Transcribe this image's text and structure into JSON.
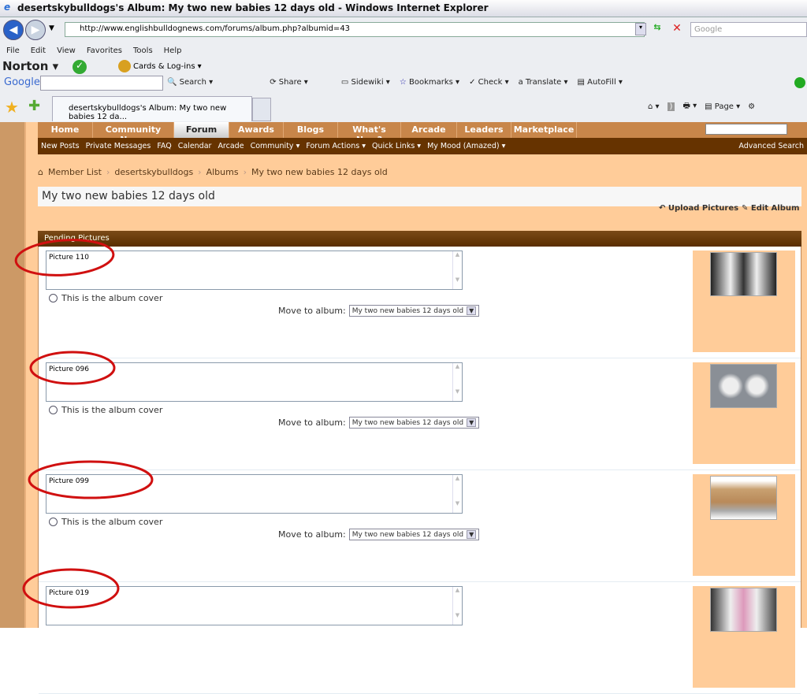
{
  "window": {
    "title": "desertskybulldogs's Album: My two new babies 12 days old - Windows Internet Explorer"
  },
  "browser": {
    "url": "http://www.englishbulldognews.com/forums/album.php?albumid=43",
    "search_placeholder": "Google",
    "menu": [
      "File",
      "Edit",
      "View",
      "Favorites",
      "Tools",
      "Help"
    ],
    "norton": {
      "label": "Norton",
      "cards": "Cards & Log-ins"
    },
    "google_toolbar": {
      "logo": "Google",
      "items": [
        "Search",
        "Share",
        "Sidewiki",
        "Bookmarks",
        "Check",
        "Translate",
        "AutoFill"
      ]
    },
    "tab": "desertskybulldogs's Album: My two new babies 12 da...",
    "page_menu": "Page"
  },
  "site": {
    "nav": [
      "Home",
      "Community News",
      "Forum",
      "Awards",
      "Blogs",
      "What's New?",
      "Arcade",
      "Leaders",
      "Marketplace ▾"
    ],
    "active_nav": "Forum",
    "subnav": [
      "New Posts",
      "Private Messages",
      "FAQ",
      "Calendar",
      "Arcade",
      "Community ▾",
      "Forum Actions ▾",
      "Quick Links ▾",
      "My Mood (Amazed) ▾"
    ],
    "advanced_search": "Advanced Search",
    "breadcrumb": [
      "Member List",
      "desertskybulldogs",
      "Albums",
      "My two new babies 12 days old"
    ],
    "album_title": "My two new babies 12 days old",
    "upload": "Upload Pictures",
    "edit": "Edit Album",
    "pending_header": "Pending Pictures",
    "cover_label": "This is the album cover",
    "move_label": "Move to album:",
    "pictures": [
      {
        "caption": "Picture 110",
        "album": "My two new babies 12 days old"
      },
      {
        "caption": "Picture 096",
        "album": "My two new babies 12 days old"
      },
      {
        "caption": "Picture 099",
        "album": "My two new babies 12 days old"
      },
      {
        "caption": "Picture 019",
        "album": "My two new babies 12 days old"
      }
    ]
  },
  "colors": {
    "page_bg": "#ffcc99",
    "nav": "#c8864a",
    "subnav": "#663300",
    "annotation": "#d01010"
  }
}
